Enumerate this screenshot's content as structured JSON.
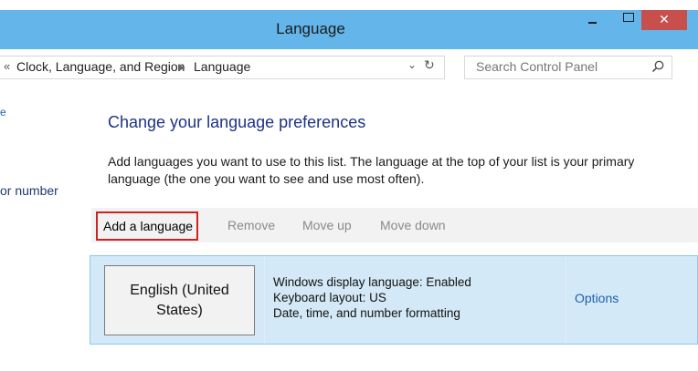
{
  "window": {
    "title": "Language",
    "close_glyph": "✕"
  },
  "address_bar": {
    "back_glyph": "«",
    "breadcrumb": [
      "Clock, Language, and Region",
      "Language"
    ],
    "separator_glyph": "▶",
    "dropdown_glyph": "⌄",
    "refresh_glyph": "↻",
    "search_placeholder": "Search Control Panel"
  },
  "sidebar": {
    "fragments": [
      "e",
      "or number"
    ]
  },
  "main": {
    "title": "Change your language preferences",
    "description": "Add languages you want to use to this list. The language at the top of your list is your primary language (the one you want to see and use most often).",
    "toolbar": {
      "add": "Add a language",
      "remove": "Remove",
      "move_up": "Move up",
      "move_down": "Move down"
    },
    "languages": [
      {
        "name": "English (United States)",
        "info": [
          "Windows display language: Enabled",
          "Keyboard layout: US",
          "Date, time, and number formatting"
        ],
        "options_label": "Options"
      }
    ]
  },
  "colors": {
    "title_bar": "#63b5ea",
    "close_button": "#c7504c",
    "link": "#1e5eb2",
    "heading": "#1e3287",
    "highlight_border": "#d12020",
    "selected_row": "#d4e9f7"
  }
}
